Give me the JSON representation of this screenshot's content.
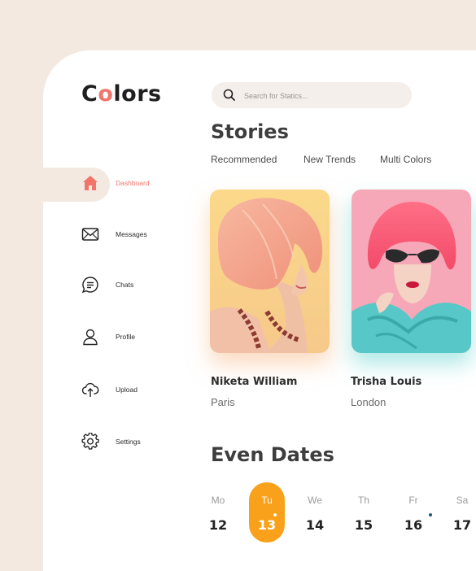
{
  "app": {
    "logo_pre": "C",
    "logo_o": "o",
    "logo_post": "lors"
  },
  "search": {
    "placeholder": "Search for Statics..."
  },
  "sidebar": {
    "items": [
      {
        "label": "Dashboard",
        "icon": "home-icon",
        "active": true
      },
      {
        "label": "Messages",
        "icon": "envelope-icon"
      },
      {
        "label": "Chats",
        "icon": "chat-bubble-icon"
      },
      {
        "label": "Profile",
        "icon": "user-icon"
      },
      {
        "label": "Upload",
        "icon": "cloud-upload-icon"
      },
      {
        "label": "Settings",
        "icon": "gear-icon"
      }
    ]
  },
  "stories": {
    "title": "Stories",
    "tabs": [
      "Recommended",
      "New Trends",
      "Multi Colors"
    ],
    "cards": [
      {
        "name": "Niketa William",
        "city": "Paris"
      },
      {
        "name": "Trisha Louis",
        "city": "London"
      }
    ]
  },
  "dates": {
    "title": "Even Dates",
    "days": [
      {
        "name": "Mo",
        "date": "12"
      },
      {
        "name": "Tu",
        "date": "13",
        "selected": true
      },
      {
        "name": "We",
        "date": "14"
      },
      {
        "name": "Th",
        "date": "15"
      },
      {
        "name": "Fr",
        "date": "16"
      },
      {
        "name": "Sa",
        "date": "17"
      }
    ]
  },
  "colors": {
    "accent": "#f0766c",
    "selected_day": "#f9a11b",
    "background": "#f4e9e1"
  }
}
